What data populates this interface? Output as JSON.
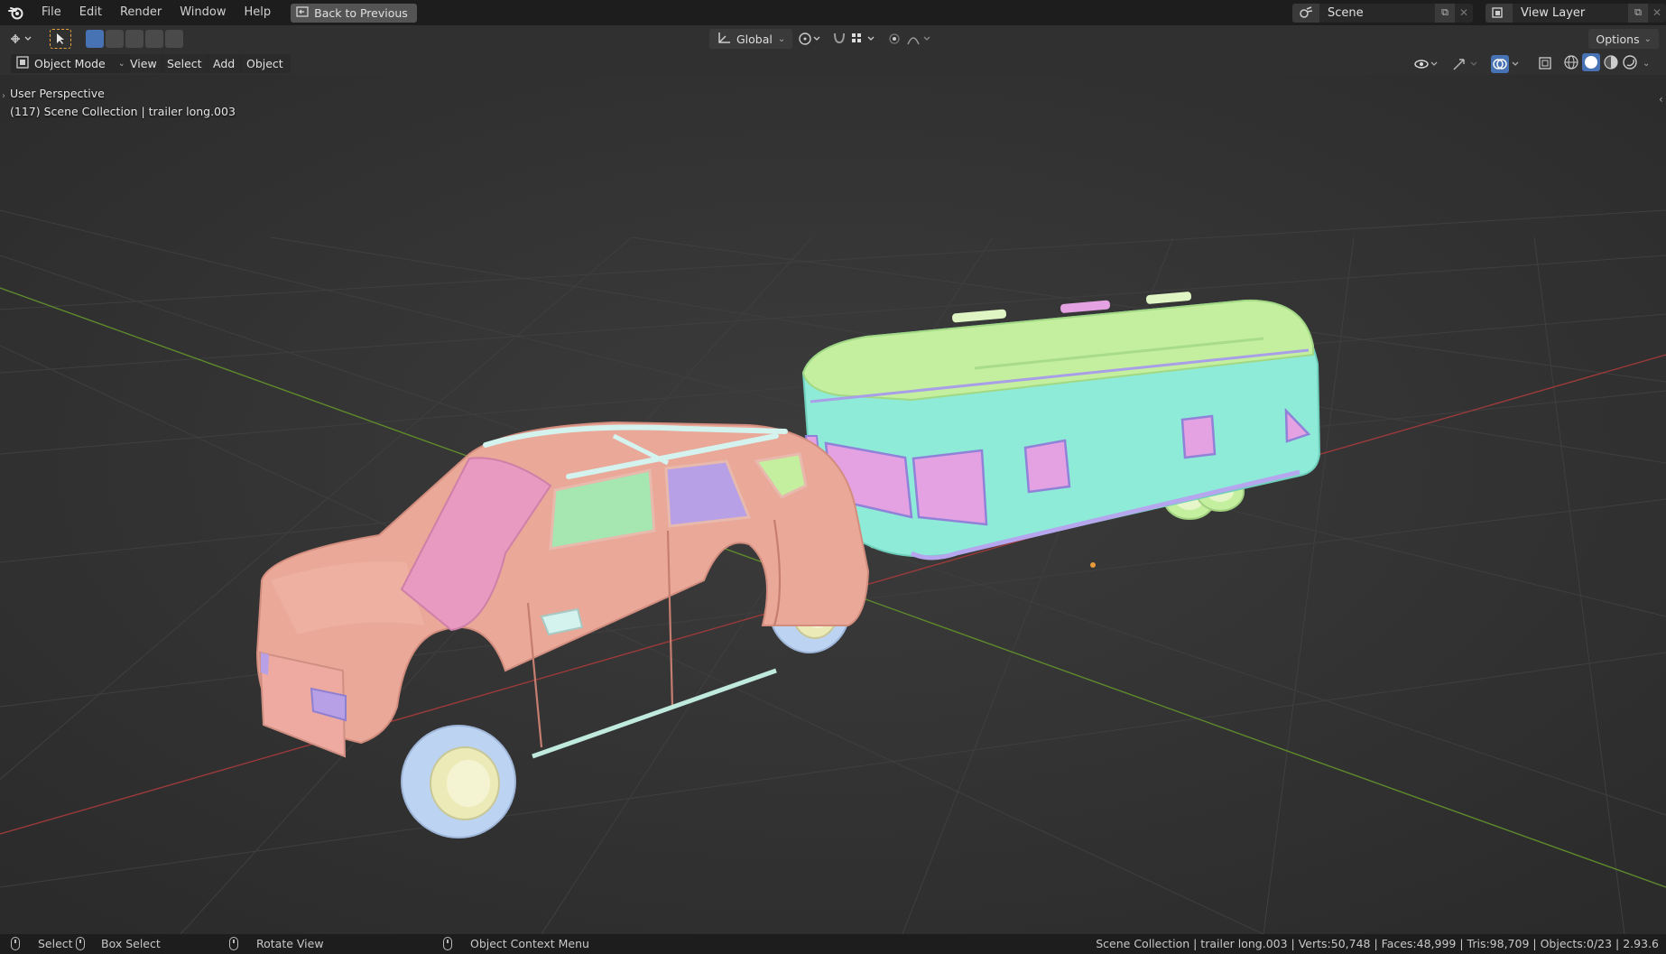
{
  "menu": {
    "items": [
      "File",
      "Edit",
      "Render",
      "Window",
      "Help"
    ],
    "back_button": "Back to Previous"
  },
  "scene": {
    "name": "Scene",
    "view_layer": "View Layer"
  },
  "toolbar": {
    "transform_orientation": "Global",
    "options_label": "Options"
  },
  "view_header": {
    "mode": "Object Mode",
    "menus": [
      "View",
      "Select",
      "Add",
      "Object"
    ]
  },
  "viewport": {
    "perspective_label": "User Perspective",
    "collection_label": "(117) Scene Collection | trailer long.003"
  },
  "statusbar": {
    "select": "Select",
    "box_select": "Box Select",
    "rotate_view": "Rotate View",
    "context_menu": "Object Context Menu",
    "stats": "Scene Collection | trailer long.003 | Verts:50,748 | Faces:48,999 | Tris:98,709 | Objects:0/23 | 2.93.6"
  },
  "colors": {
    "car_body": "#e9a898",
    "car_windshield": "#e89ac0",
    "car_window_green": "#a6e6b0",
    "car_window_purple": "#b8a0e6",
    "tire": "#bcd3f2",
    "rim": "#ecebb8",
    "trailer_body": "#8eebd8",
    "trailer_roof": "#c4ef9e",
    "trailer_window": "#e4a2e2",
    "axis_x": "#9b3a3a",
    "axis_y": "#5f8a2c",
    "selection_blue": "#4772b3"
  },
  "icons": [
    "blender-logo",
    "back-arrow-icon",
    "scene-icon",
    "view-layer-icon",
    "copy-icon",
    "close-icon",
    "cursor-icon",
    "orientation-icon",
    "pivot-icon",
    "snap-icon",
    "proportional-icon",
    "visibility-icon",
    "gizmo-icon",
    "overlay-icon",
    "xray-icon",
    "wireframe-shading-icon",
    "solid-shading-icon",
    "material-shading-icon",
    "rendered-shading-icon",
    "mouse-left-icon",
    "mouse-middle-icon",
    "mouse-right-icon"
  ]
}
